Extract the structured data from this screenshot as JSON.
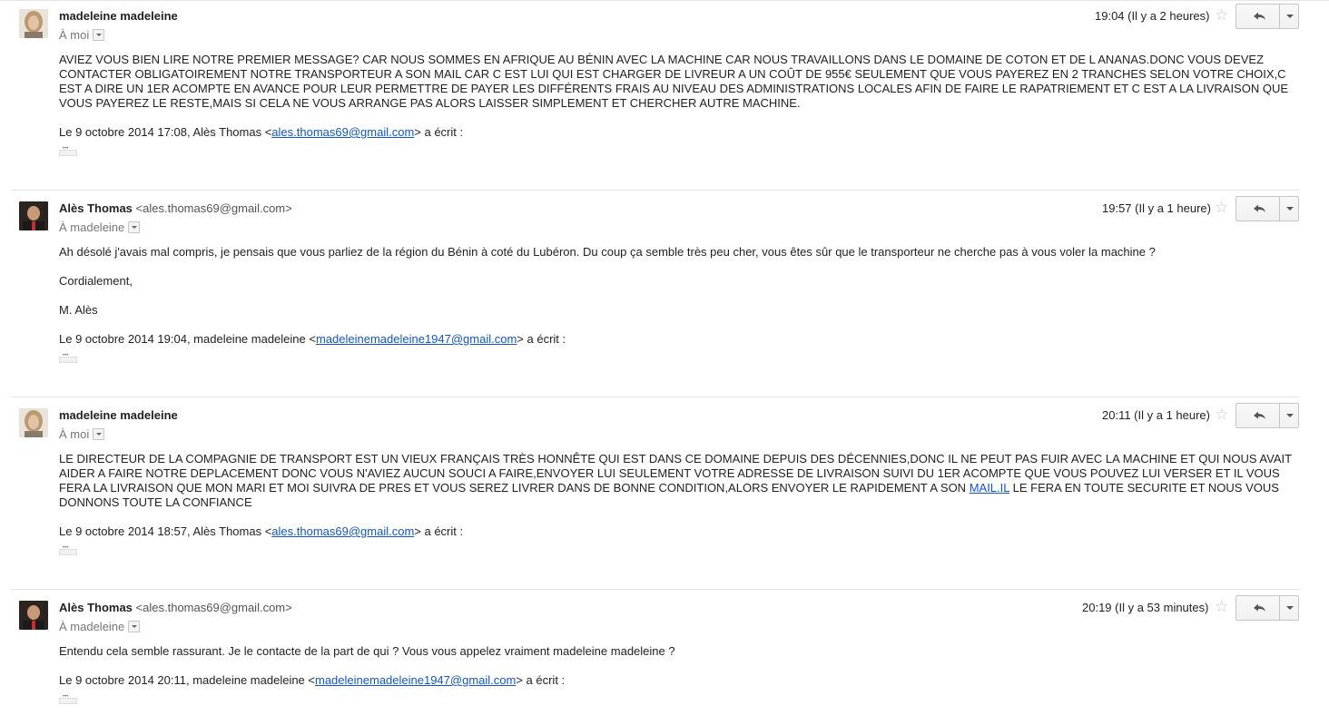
{
  "messages": [
    {
      "sender": "madeleine madeleine",
      "sender_email": "",
      "recipient": "À moi",
      "date": "19:04 (Il y a 2 heures)",
      "body": [
        "AVIEZ VOUS BIEN LIRE NOTRE PREMIER MESSAGE? CAR NOUS SOMMES EN AFRIQUE AU BÉNIN AVEC LA MACHINE CAR NOUS TRAVAILLONS DANS LE DOMAINE DE COTON ET DE L ANANAS.DONC VOUS DEVEZ CONTACTER OBLIGATOIREMENT NOTRE TRANSPORTEUR A SON MAIL CAR C EST LUI QUI EST CHARGER DE LIVREUR A UN COÛT DE 955€ SEULEMENT QUE VOUS PAYEREZ EN 2 TRANCHES SELON VOTRE CHOIX,C EST A DIRE UN 1ER  ACOMPTE EN AVANCE POUR LEUR PERMETTRE DE PAYER LES DIFFÉRENTS FRAIS AU NIVEAU DES ADMINISTRATIONS LOCALES AFIN DE FAIRE LE RAPATRIEMENT ET C EST A LA LIVRAISON QUE VOUS PAYEREZ LE RESTE,MAIS SI CELA NE VOUS ARRANGE PAS ALORS LAISSER SIMPLEMENT ET CHERCHER AUTRE MACHINE."
      ],
      "quote_prefix": "Le 9 octobre 2014 17:08, Alès Thomas <",
      "quote_link": "ales.thomas69@gmail.com",
      "quote_suffix": "> a écrit :"
    },
    {
      "sender": "Alès Thomas",
      "sender_email": "<ales.thomas69@gmail.com>",
      "recipient": "À madeleine",
      "date": "19:57 (Il y a 1 heure)",
      "body": [
        "Ah désolé j'avais mal compris, je pensais que vous parliez de la région du Bénin à coté du Lubéron. Du coup ça semble très peu cher, vous êtes sûr que le transporteur ne cherche pas à vous voler la machine ?",
        "Cordialement,",
        "M. Alès"
      ],
      "quote_prefix": "Le 9 octobre 2014 19:04, madeleine madeleine <",
      "quote_link": "madeleinemadeleine1947@gmail.com",
      "quote_suffix": "> a écrit :"
    },
    {
      "sender": "madeleine madeleine",
      "sender_email": "",
      "recipient": "À moi",
      "date": "20:11 (Il y a 1 heure)",
      "body_text": "LE DIRECTEUR DE LA COMPAGNIE DE  TRANSPORT EST UN VIEUX FRANÇAIS TRÈS HONNÊTE QUI EST DANS CE DOMAINE DEPUIS DES DÉCENNIES,DONC IL NE PEUT PAS FUIR AVEC LA MACHINE ET QUI NOUS AVAIT AIDER A FAIRE NOTRE DEPLACEMENT DONC VOUS N'AVIEZ AUCUN SOUCI A FAIRE,ENVOYER LUI SEULEMENT VOTRE ADRESSE DE LIVRAISON SUIVI DU 1ER ACOMPTE QUE VOUS POUVEZ LUI VERSER ET IL VOUS FERA LA LIVRAISON QUE MON MARI ET MOI SUIVRA DE PRES ET VOUS SEREZ LIVRER DANS DE BONNE CONDITION,ALORS ENVOYER LE RAPIDEMENT A SON ",
      "body_link": "MAIL.IL",
      "body_text_after": " LE FERA EN TOUTE SECURITE ET NOUS VOUS DONNONS TOUTE LA CONFIANCE",
      "quote_prefix": "Le 9 octobre 2014 18:57, Alès Thomas <",
      "quote_link": "ales.thomas69@gmail.com",
      "quote_suffix": "> a écrit :"
    },
    {
      "sender": "Alès Thomas",
      "sender_email": "<ales.thomas69@gmail.com>",
      "recipient": "À madeleine",
      "date": "20:19 (Il y a 53 minutes)",
      "body": [
        "Entendu cela semble rassurant. Je le contacte de la part de qui ? Vous vous appelez vraiment madeleine madeleine ?"
      ],
      "quote_prefix": "Le 9 octobre 2014 20:11, madeleine madeleine <",
      "quote_link": "madeleinemadeleine1947@gmail.com",
      "quote_suffix": "> a écrit :"
    }
  ],
  "icons": {
    "star": "star-icon",
    "reply": "reply-icon",
    "more": "chevron-down-icon",
    "expand": "ellipsis-icon"
  },
  "colors": {
    "link": "#1155cc",
    "divider": "#e5e5e5",
    "muted": "#777777"
  }
}
